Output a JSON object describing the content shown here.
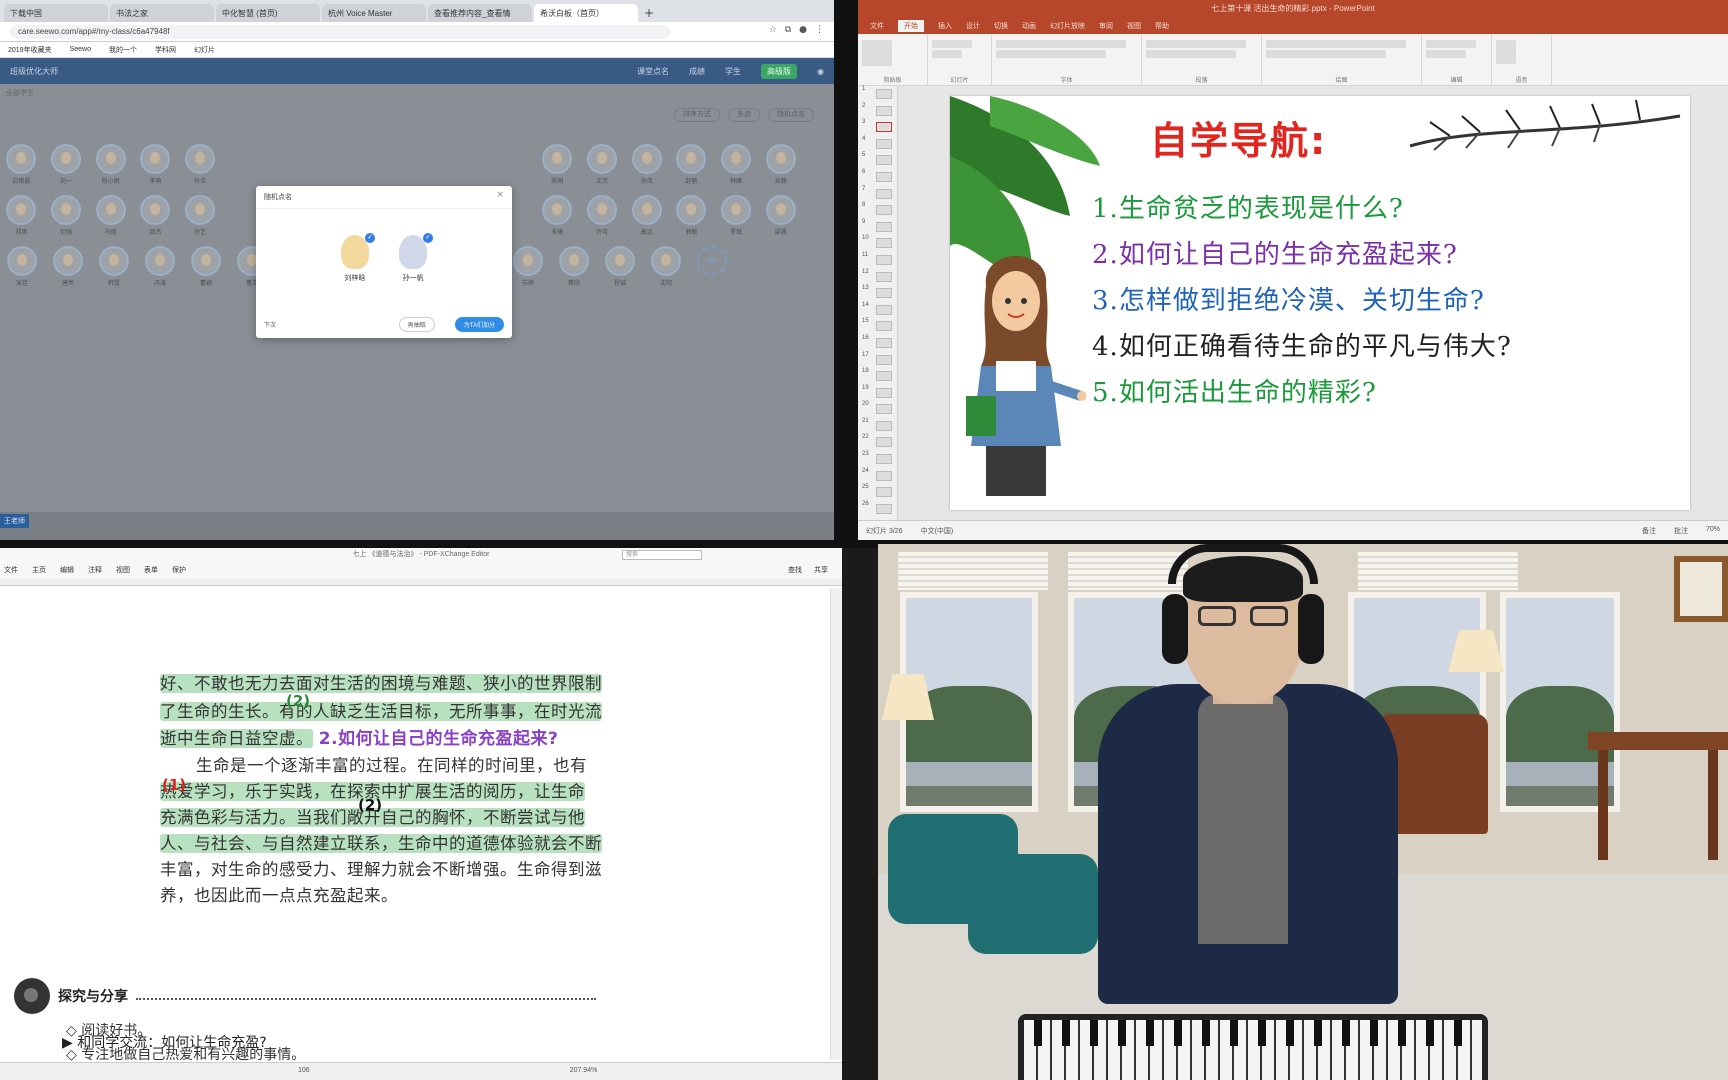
{
  "browser": {
    "tabs": [
      "下载中国",
      "书法之家",
      "中化智慧 (首页)",
      "杭州 Voice Master",
      "查看推荐内容_查看情",
      "希沃白板（首页）"
    ],
    "active_tab_index": 5,
    "url": "care.seewo.com/app#/my-class/c6a47948f",
    "bookmarks": [
      "2019年收藏夹",
      "Seewo",
      "我的一个",
      "学科网",
      "幻灯片"
    ],
    "appbar": {
      "brand": "班级优化大师",
      "items": [
        "课堂点名",
        "成绩",
        "学生",
        "高级版"
      ]
    },
    "sub_label": "全部学生",
    "filters": [
      "排序方式",
      "多选",
      "随机点名"
    ],
    "students_row1": [
      "白雨晨",
      "刘一",
      "杨小雨",
      "李萌",
      "孙浩",
      "",
      "",
      "",
      "",
      "",
      "",
      "",
      "陈明",
      "王芳",
      "张伟",
      "赵丽",
      "林峰",
      "吴静"
    ],
    "students_row2": [
      "郑爽",
      "何强",
      "马丽",
      "周杰",
      "孙艺",
      "",
      "",
      "",
      "",
      "",
      "",
      "",
      "朱琳",
      "许可",
      "高远",
      "郭敏",
      "罗斌",
      "梁晨"
    ],
    "students_row3": [
      "宋佳",
      "唐亮",
      "韩雪",
      "冯涛",
      "曹颖",
      "董浩",
      "袁梦",
      "邓超",
      "黄磊",
      "彭宇",
      "吕薇",
      "苏婷",
      "蒋欣",
      "程诚",
      "沈阳"
    ],
    "dialog": {
      "title": "随机点名",
      "people": [
        "刘梓晗",
        "孙一帆"
      ],
      "footer_left": "下次",
      "footer_cancel": "再抽取",
      "footer_confirm": "为TA们加分"
    },
    "taskbar_tag": "王老师"
  },
  "ppt": {
    "title": "七上第十课 活出生命的精彩.pptx - PowerPoint",
    "tabs": [
      "文件",
      "开始",
      "插入",
      "设计",
      "切换",
      "动画",
      "幻灯片放映",
      "审阅",
      "视图",
      "帮助"
    ],
    "active_tab_index": 1,
    "ribbon_groups": [
      "剪贴板",
      "幻灯片",
      "字体",
      "段落",
      "绘图",
      "编辑",
      "语音"
    ],
    "slide_numbers": [
      "1",
      "2",
      "3",
      "4",
      "5",
      "6",
      "7",
      "8",
      "9",
      "10",
      "11",
      "12",
      "13",
      "14",
      "15",
      "16",
      "17",
      "18",
      "19",
      "20",
      "21",
      "22",
      "23",
      "24",
      "25",
      "26"
    ],
    "active_slide": 3,
    "slide": {
      "title": "自学导航:",
      "questions": [
        {
          "num": "1.",
          "text": "生命贫乏的表现是什么?",
          "color": "#1a9a3a"
        },
        {
          "num": "2.",
          "text": "如何让自己的生命充盈起来?",
          "color": "#7b2fa8"
        },
        {
          "num": "3.",
          "text": "怎样做到拒绝冷漠、关切生命?",
          "color": "#1f63b8"
        },
        {
          "num": "4.",
          "text": "如何正确看待生命的平凡与伟大?",
          "color": "#222222"
        },
        {
          "num": "5.",
          "text": "如何活出生命的精彩?",
          "color": "#1a9a3a"
        }
      ]
    },
    "status": {
      "slide_info": "幻灯片 3/26",
      "lang": "中文(中国)",
      "notes": "备注",
      "comments": "批注",
      "zoom": "70%"
    }
  },
  "pdf": {
    "title": "七上 《道德与法治》 - PDF-XChange Editor",
    "search_placeholder": "搜索",
    "menus": [
      "文件",
      "主页",
      "编辑",
      "注释",
      "视图",
      "表单",
      "保护"
    ],
    "menu_right": [
      "查找",
      "共享"
    ],
    "lines": [
      "好、不敢也无力去面对生活的困境与难题、狭小的世界限制",
      "了生命的生长。有的人缺乏生活目标，无所事事，在时光流",
      "逝中生命日益空虚。",
      "生命是一个逐渐丰富的过程。在同样的时间里，也有",
      "热爱学习，乐于实践，在探索中扩展生活的阅历，让生命",
      "充满色彩与活力。当我们敞开自己的胸怀，不断尝试与他",
      "人、与社会、与自然建立联系，生命中的道德体验就会不断",
      "丰富，对生命的感受力、理解力就会不断增强。生命得到滋",
      "养，也因此而一点点充盈起来。"
    ],
    "question2": "2.如何让自己的生命充盈起来?",
    "marks": [
      "(2)",
      "(1)",
      "(2)"
    ],
    "section_title": "探究与分享",
    "section_prompt": "和同学交流：如何让生命充盈?",
    "bullets": [
      "◇ 阅读好书。",
      "◇ 专注地做自己热爱和有兴趣的事情。"
    ],
    "status": {
      "page": "106",
      "zoom": "207.94%"
    }
  },
  "colors": {
    "ppt_red": "#b7472a",
    "highlight_green": "#7dc88c",
    "mark_red": "#d9261c",
    "appbar_blue": "#3a5a86"
  }
}
